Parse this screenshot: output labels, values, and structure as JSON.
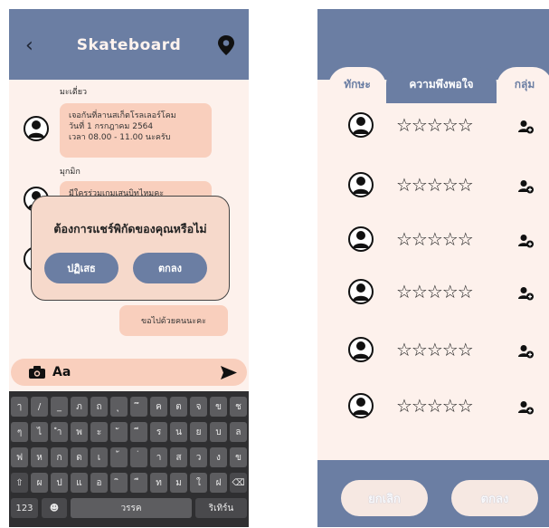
{
  "chat": {
    "title": "Skateboard",
    "messages": [
      {
        "sender": "มะเดี่ยว",
        "lines": [
          "เจอกันที่ลานสเก็ตโรลเลอร์โคม",
          "วันที่ 1 กรกฎาคม 2564",
          "เวลา 08.00 - 11.00 นะครับ"
        ]
      },
      {
        "sender": "มุกมิก",
        "lines": [
          "มีใครร่วมเกมเสนบิทไหมคะ"
        ]
      }
    ],
    "dialog": {
      "question": "ต้องการแชร์พิกัดของคุณหรือไม่",
      "reject_label": "ปฏิเสธ",
      "accept_label": "ตกลง"
    },
    "reply": "ขอไปด้วยคนนะคะ",
    "composer_label": "Aa"
  },
  "keyboard": {
    "row1": [
      "ๅ",
      "/",
      "_",
      "ภ",
      "ถ",
      "ุ",
      "ึ",
      "ค",
      "ต",
      "จ",
      "ข",
      "ช"
    ],
    "row2": [
      "ๆ",
      "ไ",
      "ำ",
      "พ",
      "ะ",
      "ั",
      "ี",
      "ร",
      "น",
      "ย",
      "บ",
      "ล"
    ],
    "row3": [
      "ฟ",
      "ห",
      "ก",
      "ด",
      "เ",
      "้",
      "่",
      "า",
      "ส",
      "ว",
      "ง",
      "ข"
    ],
    "row4": [
      "⇧",
      "ผ",
      "ป",
      "แ",
      "อ",
      "ิ",
      "ื",
      "ท",
      "ม",
      "ใ",
      "ฝ",
      "⌫"
    ],
    "row5": {
      "numbers": "123",
      "emoji": "☻",
      "space": "วรรค",
      "enter": "ริเทิร์น"
    }
  },
  "rating": {
    "tabs": [
      "ทักษะ",
      "ความพึงพอใจ",
      "กลุ่ม"
    ],
    "active_tab": 1,
    "rows": [
      {
        "stars": "☆☆☆☆☆"
      },
      {
        "stars": "☆☆☆☆☆"
      },
      {
        "stars": "☆☆☆☆☆"
      },
      {
        "stars": "☆☆☆☆☆"
      },
      {
        "stars": "☆☆☆☆☆"
      },
      {
        "stars": "☆☆☆☆☆"
      }
    ],
    "cancel_label": "ยกเลิก",
    "ok_label": "ตกลง"
  },
  "colors": {
    "accent": "#6b7ea3",
    "background": "#fdf1ec",
    "bubble": "#f9cfbd"
  }
}
